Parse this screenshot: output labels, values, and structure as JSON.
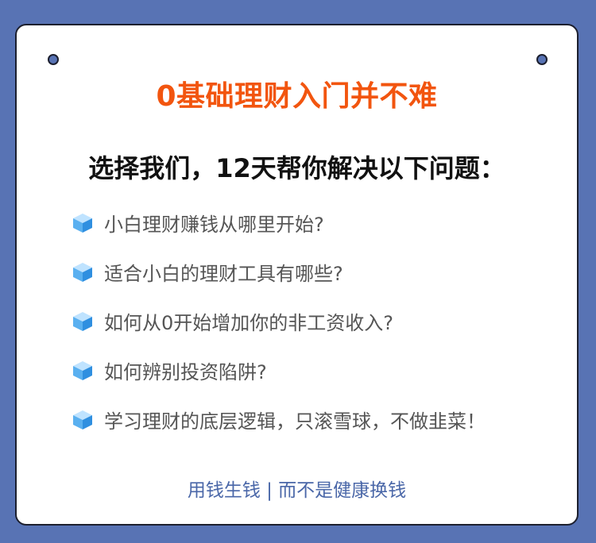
{
  "headline": "0基础理财入门并不难",
  "subtitle": "选择我们，12天帮你解决以下问题：",
  "items": [
    {
      "text": "小白理财赚钱从哪里开始?"
    },
    {
      "text": "适合小白的理财工具有哪些?"
    },
    {
      "text": "如何从0开始增加你的非工资收入?"
    },
    {
      "text": "如何辨别投资陷阱?"
    },
    {
      "text": "学习理财的底层逻辑，只滚雪球，不做韭菜！"
    }
  ],
  "footer": "用钱生钱 | 而不是健康换钱",
  "colors": {
    "background": "#5873b4",
    "headline": "#f2550f",
    "footer": "#4a67a8",
    "cube_top": "#bfe3ff",
    "cube_left": "#5ab0f0",
    "cube_right": "#2f8fe0"
  },
  "icons": {
    "bullet": "cube-icon"
  }
}
